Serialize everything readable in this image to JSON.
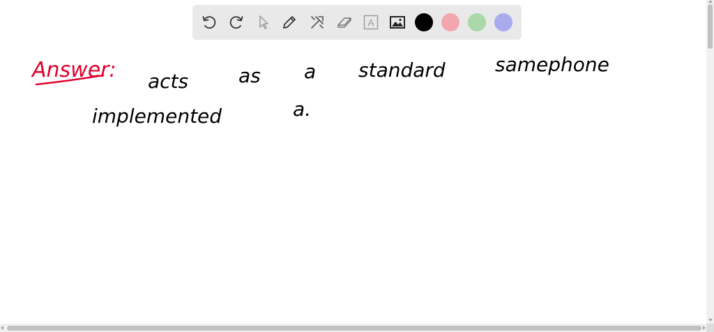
{
  "toolbar": {
    "tools": [
      {
        "name": "undo",
        "icon": "undo-icon"
      },
      {
        "name": "redo",
        "icon": "redo-icon"
      },
      {
        "name": "select",
        "icon": "cursor-icon"
      },
      {
        "name": "pen",
        "icon": "pencil-icon"
      },
      {
        "name": "tools",
        "icon": "tools-icon"
      },
      {
        "name": "eraser",
        "icon": "eraser-icon"
      },
      {
        "name": "text",
        "icon": "text-box-icon",
        "glyph": "A"
      },
      {
        "name": "image",
        "icon": "image-icon"
      }
    ],
    "colors": [
      "#000000",
      "#f2a7b0",
      "#a9d8a9",
      "#aaaaee"
    ]
  },
  "whiteboard": {
    "answer_label": "Answer:",
    "answer_color": "#e0002a",
    "ink_color": "#000000",
    "line1": [
      "acts",
      "as",
      "a",
      "standard",
      "samephone"
    ],
    "line2": [
      "implemented",
      "a."
    ]
  }
}
